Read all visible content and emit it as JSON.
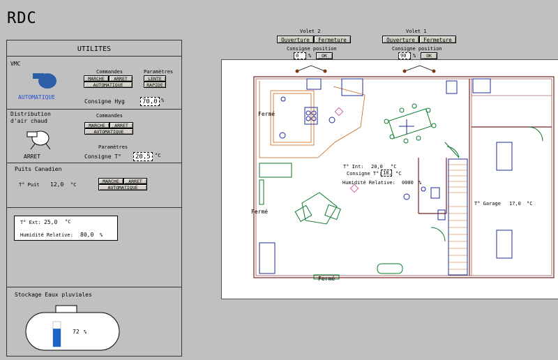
{
  "page_title": "RDC",
  "utilites": {
    "title": "UTILITES",
    "vmc": {
      "label": "VMC",
      "status": "AUTOMATIQUE",
      "commandes_label": "Commandes",
      "parametres_label": "Paramètres",
      "btn_marche": "MARCHE",
      "btn_arret": "ARRET",
      "btn_automatique": "AUTOMATIQUE",
      "btn_lente": "LENTE",
      "btn_rapide": "RAPIDE",
      "consigne_label": "Consigne Hyg",
      "consigne_value": "70,0",
      "consigne_unit": "%"
    },
    "distribution": {
      "label_line1": "Distribution",
      "label_line2": "d'air chaud",
      "status": "ARRET",
      "commandes_label": "Commandes",
      "btn_marche": "MARCHE",
      "btn_arret": "ARRET",
      "btn_automatique": "AUTOMATIQUE",
      "parametres_label": "Paramètres",
      "consigne_label": "Consigne T°",
      "consigne_value": "20,5",
      "consigne_unit": "°C"
    },
    "puits": {
      "label": "Puits Canadien",
      "temp_label": "T° Puit",
      "temp_value": "12,0",
      "temp_unit": "°C",
      "btn_marche": "MARCHE",
      "btn_arret": "ARRET",
      "btn_automatique": "AUTOMATIQUE"
    },
    "exterieur": {
      "text_label": "T° Ext:",
      "text_value": "25,0",
      "text_unit": "°C",
      "hum_label": "Humidité Relative:",
      "hum_value": "80,0",
      "hum_unit": "%"
    },
    "stockage": {
      "label": "Stockage Eaux pluviales",
      "level_percent": 72,
      "level_text": "72",
      "level_unit": "%"
    }
  },
  "volets": [
    {
      "title": "Volet 2",
      "btn_ouverture": "Ouverture",
      "btn_fermeture": "Fermeture",
      "consigne_label": "Consigne position",
      "value": "0",
      "unit": "%",
      "ok": "OK"
    },
    {
      "title": "Volet 1",
      "btn_ouverture": "Ouverture",
      "btn_fermeture": "Fermeture",
      "consigne_label": "Consigne position",
      "value": "90",
      "unit": "%",
      "ok": "OK"
    }
  ],
  "plan": {
    "ferme_label": "Fermé",
    "tint_label": "T° Int:",
    "tint_value": "20,0",
    "tint_unit": "°C",
    "consigne_label": "Consigne T°:",
    "consigne_value": "18,",
    "consigne_unit": "°C",
    "hum_label": "Humidité Relative:",
    "hum_value": "0000",
    "hum_unit": "%",
    "garage_label": "T° Garage",
    "garage_value": "17,0",
    "garage_unit": "°C"
  },
  "colors": {
    "wall": "#7a2020",
    "furniture_green": "#0a7a2a",
    "furniture_blue": "#1e2a9a",
    "tank_fill": "#1e64c8",
    "status_blue": "#1e50d0"
  }
}
